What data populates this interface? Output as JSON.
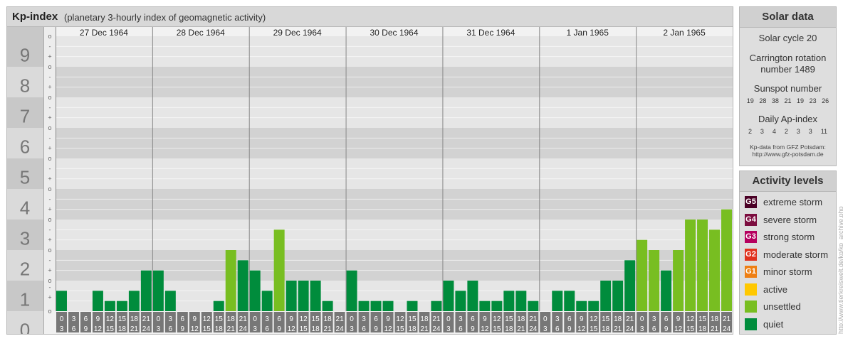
{
  "header": {
    "title": "Kp-index",
    "subtitle": "(planetary 3-hourly index of geomagnetic activity)"
  },
  "chart_data": {
    "type": "bar",
    "title": "Kp-index",
    "subtitle": "(planetary 3-hourly index of geomagnetic activity)",
    "ylim": [
      0,
      9
    ],
    "y_ticks": [
      "0",
      "1",
      "2",
      "3",
      "4",
      "5",
      "6",
      "7",
      "8",
      "9"
    ],
    "minor_marks": [
      "o",
      "+",
      "-"
    ],
    "days": [
      "27 Dec 1964",
      "28 Dec 1964",
      "29 Dec 1964",
      "30 Dec 1964",
      "31 Dec 1964",
      "1 Jan 1965",
      "2 Jan 1965"
    ],
    "interval_labels": [
      [
        "0",
        "3"
      ],
      [
        "3",
        "6"
      ],
      [
        "6",
        "9"
      ],
      [
        "9",
        "12"
      ],
      [
        "12",
        "15"
      ],
      [
        "15",
        "18"
      ],
      [
        "18",
        "21"
      ],
      [
        "21",
        "24"
      ]
    ],
    "values": [
      0.667,
      0,
      0,
      0.667,
      0.333,
      0.333,
      0.667,
      1.333,
      1.333,
      0.667,
      0,
      0,
      0,
      0.333,
      2,
      1.667,
      1.333,
      0.667,
      2.667,
      1,
      1,
      1,
      0.333,
      0,
      1.333,
      0.333,
      0.333,
      0.333,
      0,
      0.333,
      0,
      0.333,
      1,
      0.667,
      1,
      0.333,
      0.333,
      0.667,
      0.667,
      0.333,
      0,
      0.667,
      0.667,
      0.333,
      0.333,
      1,
      1,
      1.667,
      2.333,
      2,
      1.333,
      2,
      3,
      3,
      2.667,
      3.333
    ],
    "level_colors": {
      "quiet": "#008c3c",
      "unsettled": "#78be21"
    },
    "grid": true
  },
  "solar_data": {
    "title": "Solar data",
    "cycle": "Solar cycle 20",
    "carrington_line1": "Carrington rotation",
    "carrington_line2": "number 1489",
    "sunspot_title": "Sunspot number",
    "sunspot_values": [
      "19",
      "28",
      "38",
      "21",
      "19",
      "23",
      "26"
    ],
    "ap_title": "Daily Ap-index",
    "ap_values": [
      "2",
      "3",
      "4",
      "2",
      "3",
      "3",
      "11"
    ],
    "credit_line1": "Kp-data from GFZ Potsdam:",
    "credit_line2": "http://www.gfz-potsdam.de"
  },
  "activity_levels": {
    "title": "Activity levels",
    "items": [
      {
        "badge": "G5",
        "label": "extreme storm",
        "color": "#4a0025"
      },
      {
        "badge": "G4",
        "label": "severe storm",
        "color": "#7c0d3f"
      },
      {
        "badge": "G3",
        "label": "strong storm",
        "color": "#b5005f"
      },
      {
        "badge": "G2",
        "label": "moderate storm",
        "color": "#e0321e"
      },
      {
        "badge": "G1",
        "label": "minor storm",
        "color": "#ee7f14"
      },
      {
        "badge": "",
        "label": "active",
        "color": "#ffc800"
      },
      {
        "badge": "",
        "label": "unsettled",
        "color": "#78be21"
      },
      {
        "badge": "",
        "label": "quiet",
        "color": "#008c3c"
      }
    ]
  },
  "source_url": "http://www.tierkreiswelt.de/kp/kp_archive.php"
}
